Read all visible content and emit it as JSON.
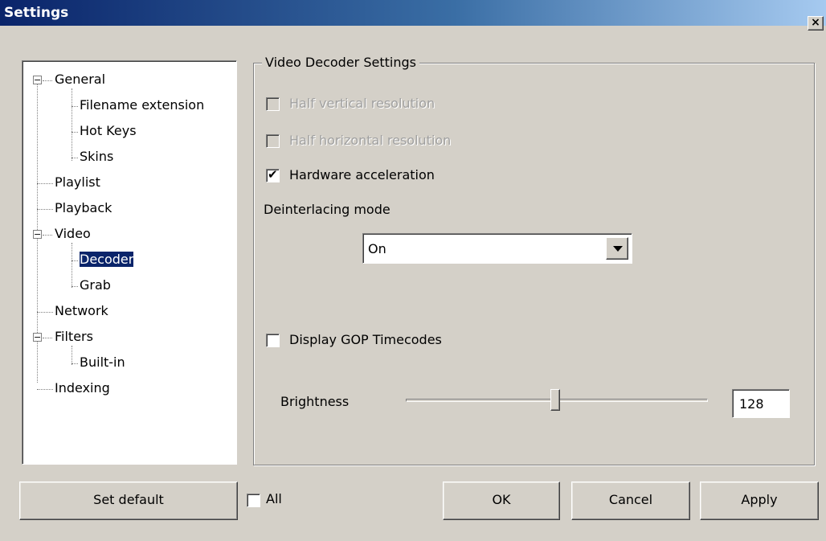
{
  "window": {
    "title": "Settings",
    "close_glyph": "×"
  },
  "tree": {
    "items": [
      {
        "label": "General",
        "expander": "−"
      },
      {
        "label": "Filename extension"
      },
      {
        "label": "Hot Keys"
      },
      {
        "label": "Skins"
      },
      {
        "label": "Playlist"
      },
      {
        "label": "Playback"
      },
      {
        "label": "Video",
        "expander": "−"
      },
      {
        "label": "Decoder",
        "selected": true
      },
      {
        "label": "Grab"
      },
      {
        "label": "Network"
      },
      {
        "label": "Filters",
        "expander": "−"
      },
      {
        "label": "Built-in"
      },
      {
        "label": "Indexing"
      }
    ]
  },
  "group": {
    "title": "Video Decoder Settings",
    "half_vertical": {
      "label": "Half vertical resolution",
      "checked": false,
      "enabled": false
    },
    "half_horizontal": {
      "label": "Half horizontal resolution",
      "checked": false,
      "enabled": false
    },
    "hw_accel": {
      "label": "Hardware acceleration",
      "checked": true,
      "mark": "✔"
    },
    "deinterlace": {
      "label": "Deinterlacing mode",
      "value": "On"
    },
    "gop": {
      "label": "Display GOP Timecodes",
      "checked": false
    },
    "brightness": {
      "label": "Brightness",
      "value": "128",
      "level": 128,
      "max": 255
    }
  },
  "footer": {
    "set_default": "Set default",
    "all_label": "All",
    "ok": "OK",
    "cancel": "Cancel",
    "apply": "Apply"
  },
  "colors": {
    "title_start": "#0a246a",
    "title_end": "#a6caf0",
    "face": "#d4d0c8",
    "selection": "#0a246a"
  }
}
